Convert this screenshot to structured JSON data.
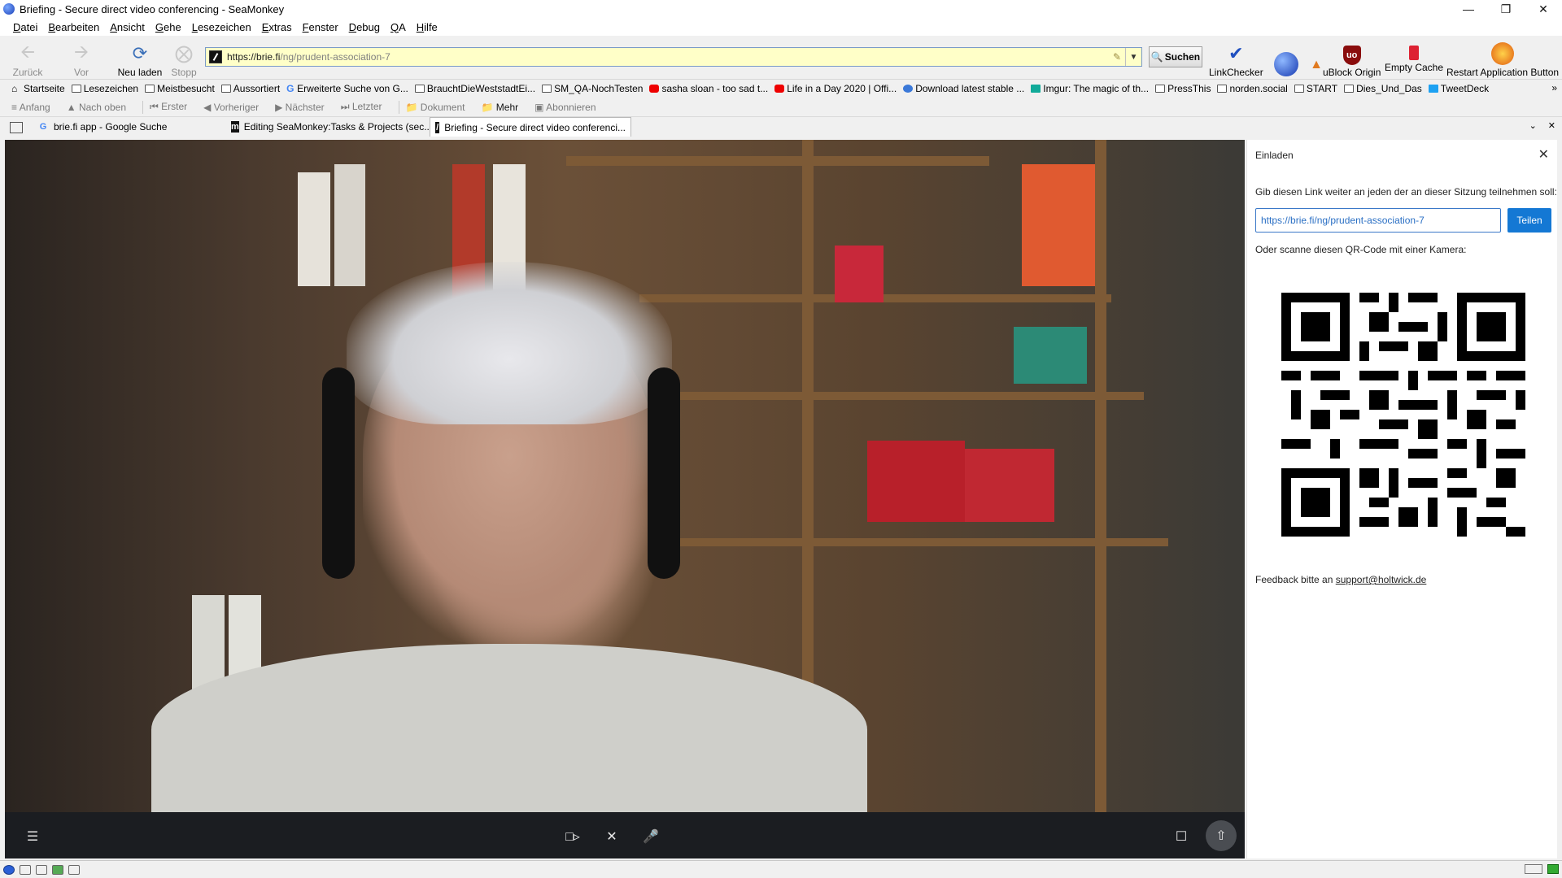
{
  "window": {
    "title": "Briefing - Secure direct video conferencing - SeaMonkey"
  },
  "menu": [
    "Datei",
    "Bearbeiten",
    "Ansicht",
    "Gehe",
    "Lesezeichen",
    "Extras",
    "Fenster",
    "Debug",
    "QA",
    "Hilfe"
  ],
  "nav": {
    "back": "Zurück",
    "forward": "Vor",
    "reload": "Neu laden",
    "stop": "Stopp",
    "url_host": "https://brie.fi",
    "url_path": "/ng/prudent-association-7",
    "search": "Suchen"
  },
  "extensions": {
    "linkchecker": "LinkChecker",
    "ublock": "uBlock Origin",
    "empty_cache": "Empty Cache",
    "restart": "Restart Application Button"
  },
  "bookmarks": [
    {
      "label": "Startseite",
      "icon": "home"
    },
    {
      "label": "Lesezeichen",
      "icon": "folder"
    },
    {
      "label": "Meistbesucht",
      "icon": "folder"
    },
    {
      "label": "Aussortiert",
      "icon": "folder"
    },
    {
      "label": "Erweiterte Suche von G...",
      "icon": "g"
    },
    {
      "label": "BrauchtDieWeststadtEi...",
      "icon": "page"
    },
    {
      "label": "SM_QA-NochTesten",
      "icon": "folder"
    },
    {
      "label": "sasha sloan - too sad t...",
      "icon": "yt"
    },
    {
      "label": "Life in a Day 2020 | Offi...",
      "icon": "yt"
    },
    {
      "label": "Download latest stable ...",
      "icon": "page"
    },
    {
      "label": "Imgur: The magic of th...",
      "icon": "page"
    },
    {
      "label": "PressThis",
      "icon": "folder"
    },
    {
      "label": "norden.social",
      "icon": "folder"
    },
    {
      "label": "START",
      "icon": "folder"
    },
    {
      "label": "Dies_Und_Das",
      "icon": "folder"
    },
    {
      "label": "TweetDeck",
      "icon": "page"
    }
  ],
  "feedbar": {
    "anfang": "Anfang",
    "nach_oben": "Nach oben",
    "erster": "Erster",
    "vorheriger": "Vorheriger",
    "naechster": "Nächster",
    "letzter": "Letzter",
    "dokument": "Dokument",
    "mehr": "Mehr",
    "abonnieren": "Abonnieren"
  },
  "tabs": [
    {
      "label": "brie.fi app - Google Suche",
      "icon": "G"
    },
    {
      "label": "Editing SeaMonkey:Tasks & Projects (sec...",
      "icon": "m"
    },
    {
      "label": "Briefing - Secure direct video conferenci...",
      "icon": "b",
      "active": true
    }
  ],
  "invite": {
    "title": "Einladen",
    "description": "Gib diesen Link weiter an jeden der an dieser Sitzung teilnehmen soll:",
    "link": "https://brie.fi/ng/prudent-association-7",
    "share_button": "Teilen",
    "scan_text": "Oder scanne diesen QR-Code mit einer Kamera:",
    "feedback_prefix": "Feedback bitte an",
    "feedback_email": "support@holtwick.de"
  },
  "colors": {
    "accent": "#1478d4",
    "url_bg": "#ffffc8",
    "video_bar": "#1b1d21"
  }
}
